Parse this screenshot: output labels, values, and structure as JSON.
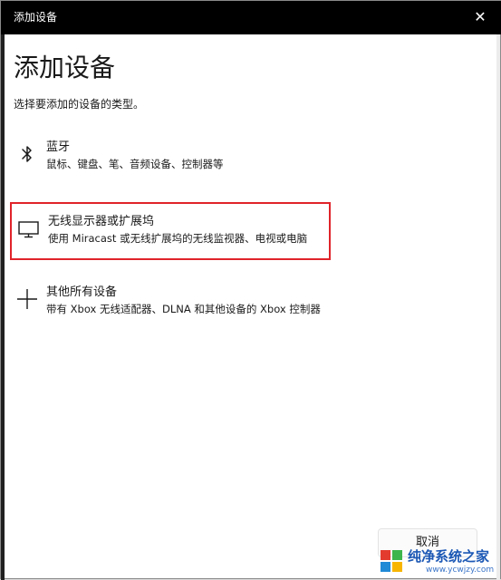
{
  "window": {
    "title": "添加设备",
    "close_icon": "close-icon"
  },
  "main": {
    "heading": "添加设备",
    "subheading": "选择要添加的设备的类型。",
    "options": [
      {
        "name": "蓝牙",
        "description": "鼠标、键盘、笔、音频设备、控制器等",
        "icon": "bluetooth-icon",
        "selected": false
      },
      {
        "name": "无线显示器或扩展坞",
        "description": "使用 Miracast 或无线扩展坞的无线监视器、电视或电脑",
        "icon": "monitor-icon",
        "selected": true
      },
      {
        "name": "其他所有设备",
        "description": "带有 Xbox 无线适配器、DLNA 和其他设备的 Xbox 控制器",
        "icon": "plus-icon",
        "selected": false
      }
    ]
  },
  "footer": {
    "cancel_label": "取消"
  },
  "watermark": {
    "text": "纯净系统之家",
    "url": "www.ycwjzy.com"
  },
  "colors": {
    "titlebar": "#000000",
    "selection_border": "#e0242a",
    "watermark_blue": "#1c58b5"
  }
}
